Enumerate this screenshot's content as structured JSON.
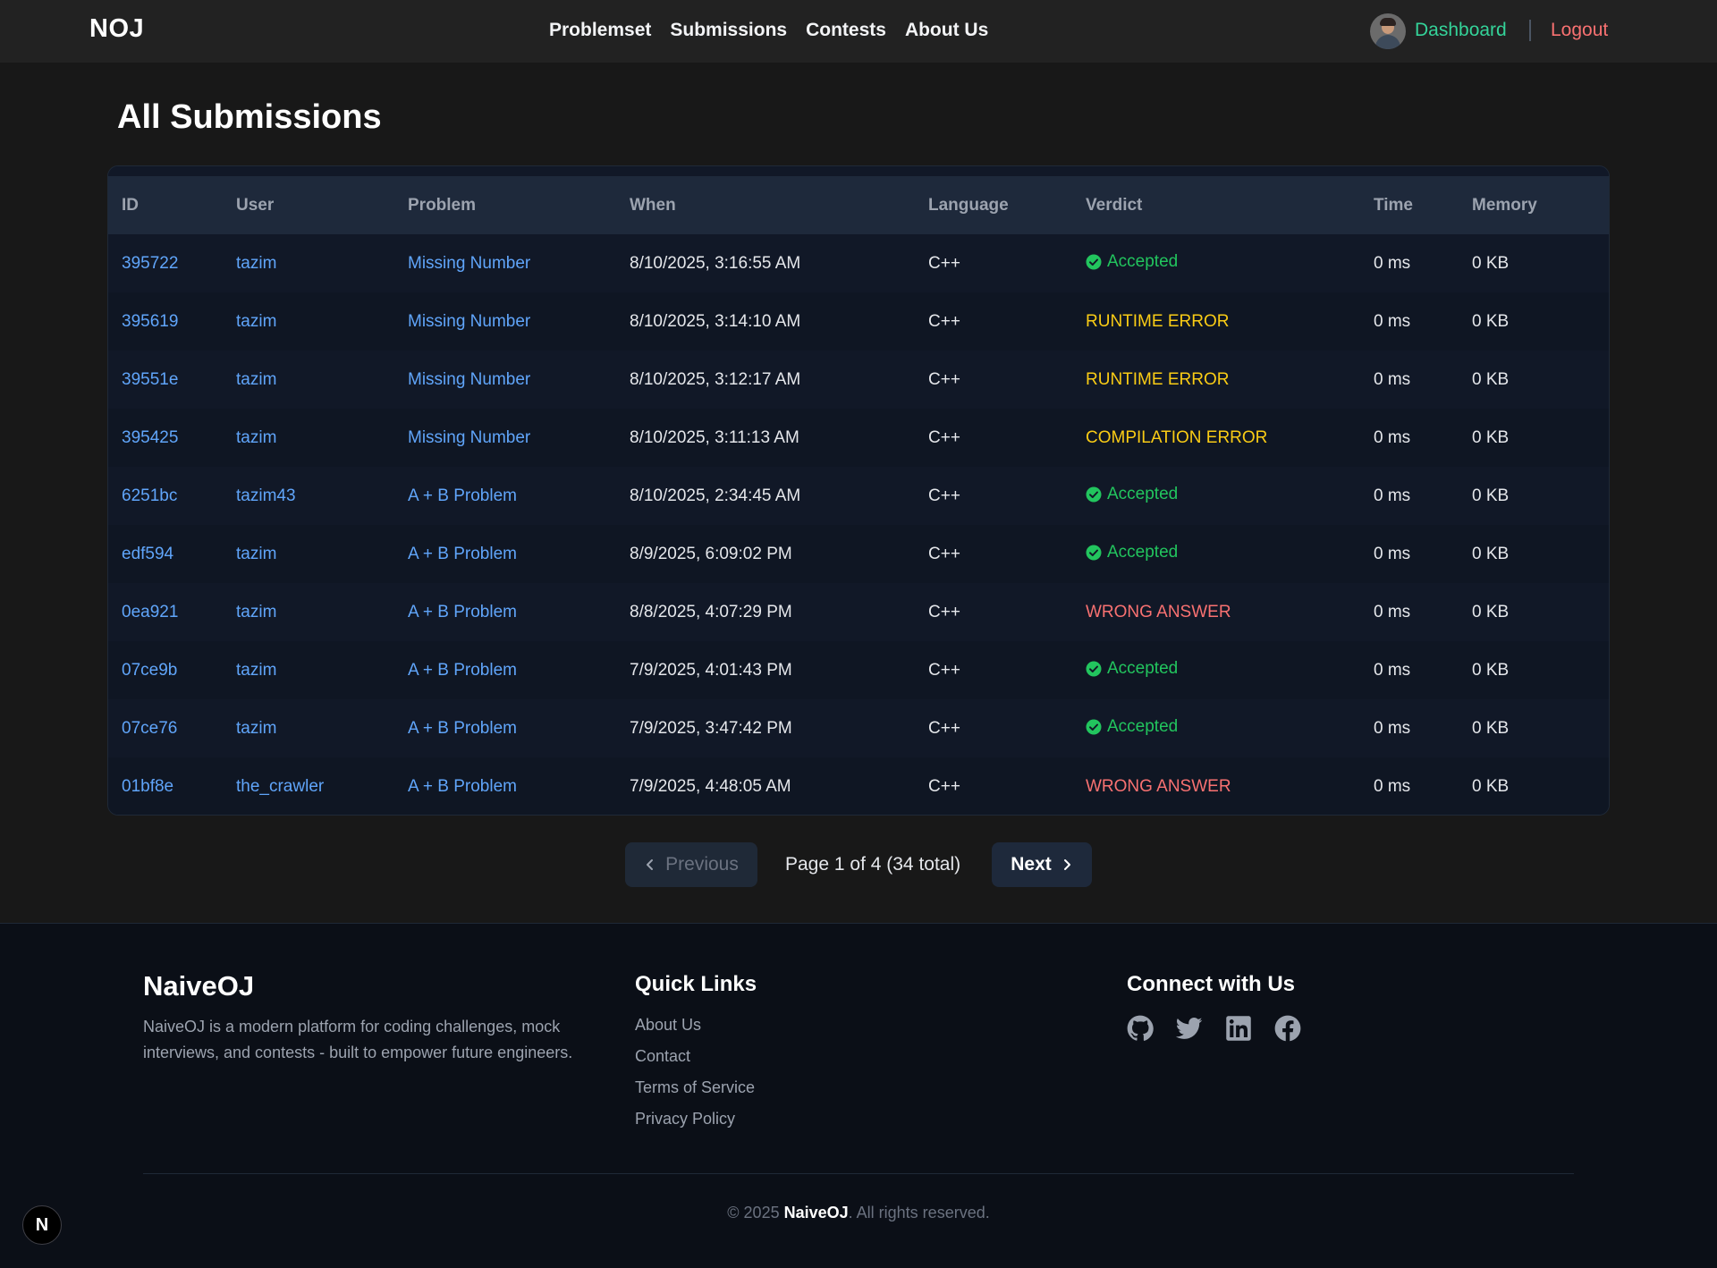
{
  "header": {
    "brand": "NOJ",
    "nav": [
      "Problemset",
      "Submissions",
      "Contests",
      "About Us"
    ],
    "dashboard_label": "Dashboard",
    "logout_label": "Logout"
  },
  "page_title": "All Submissions",
  "table": {
    "columns": [
      "ID",
      "User",
      "Problem",
      "When",
      "Language",
      "Verdict",
      "Time",
      "Memory"
    ],
    "rows": [
      {
        "id": "395722",
        "user": "tazim",
        "problem": "Missing Number",
        "when": "8/10/2025, 3:16:55 AM",
        "language": "C++",
        "verdict": "Accepted",
        "time": "0 ms",
        "memory": "0 KB"
      },
      {
        "id": "395619",
        "user": "tazim",
        "problem": "Missing Number",
        "when": "8/10/2025, 3:14:10 AM",
        "language": "C++",
        "verdict": "RUNTIME ERROR",
        "time": "0 ms",
        "memory": "0 KB"
      },
      {
        "id": "39551e",
        "user": "tazim",
        "problem": "Missing Number",
        "when": "8/10/2025, 3:12:17 AM",
        "language": "C++",
        "verdict": "RUNTIME ERROR",
        "time": "0 ms",
        "memory": "0 KB"
      },
      {
        "id": "395425",
        "user": "tazim",
        "problem": "Missing Number",
        "when": "8/10/2025, 3:11:13 AM",
        "language": "C++",
        "verdict": "COMPILATION ERROR",
        "time": "0 ms",
        "memory": "0 KB"
      },
      {
        "id": "6251bc",
        "user": "tazim43",
        "problem": "A + B Problem",
        "when": "8/10/2025, 2:34:45 AM",
        "language": "C++",
        "verdict": "Accepted",
        "time": "0 ms",
        "memory": "0 KB"
      },
      {
        "id": "edf594",
        "user": "tazim",
        "problem": "A + B Problem",
        "when": "8/9/2025, 6:09:02 PM",
        "language": "C++",
        "verdict": "Accepted",
        "time": "0 ms",
        "memory": "0 KB"
      },
      {
        "id": "0ea921",
        "user": "tazim",
        "problem": "A + B Problem",
        "when": "8/8/2025, 4:07:29 PM",
        "language": "C++",
        "verdict": "WRONG ANSWER",
        "time": "0 ms",
        "memory": "0 KB"
      },
      {
        "id": "07ce9b",
        "user": "tazim",
        "problem": "A + B Problem",
        "when": "7/9/2025, 4:01:43 PM",
        "language": "C++",
        "verdict": "Accepted",
        "time": "0 ms",
        "memory": "0 KB"
      },
      {
        "id": "07ce76",
        "user": "tazim",
        "problem": "A + B Problem",
        "when": "7/9/2025, 3:47:42 PM",
        "language": "C++",
        "verdict": "Accepted",
        "time": "0 ms",
        "memory": "0 KB"
      },
      {
        "id": "01bf8e",
        "user": "the_crawler",
        "problem": "A + B Problem",
        "when": "7/9/2025, 4:48:05 AM",
        "language": "C++",
        "verdict": "WRONG ANSWER",
        "time": "0 ms",
        "memory": "0 KB"
      }
    ]
  },
  "pagination": {
    "prev_label": "Previous",
    "page_info": "Page 1 of 4 (34 total)",
    "next_label": "Next"
  },
  "footer": {
    "brand": "NaiveOJ",
    "description": "NaiveOJ is a modern platform for coding challenges, mock interviews, and contests - built to empower future engineers.",
    "quick_links_heading": "Quick Links",
    "quick_links": [
      "About Us",
      "Contact",
      "Terms of Service",
      "Privacy Policy"
    ],
    "connect_heading": "Connect with Us",
    "social_icons": [
      "github-icon",
      "twitter-icon",
      "linkedin-icon",
      "facebook-icon"
    ],
    "copyright_prefix": "© 2025",
    "copyright_brand": "NaiveOJ",
    "copyright_suffix": ". All rights reserved."
  },
  "floating_badge": "N",
  "colors": {
    "accepted": "#22c55e",
    "error": "#facc15",
    "wrong": "#f87171",
    "link": "#60a5fa",
    "dashboard": "#34d399"
  }
}
